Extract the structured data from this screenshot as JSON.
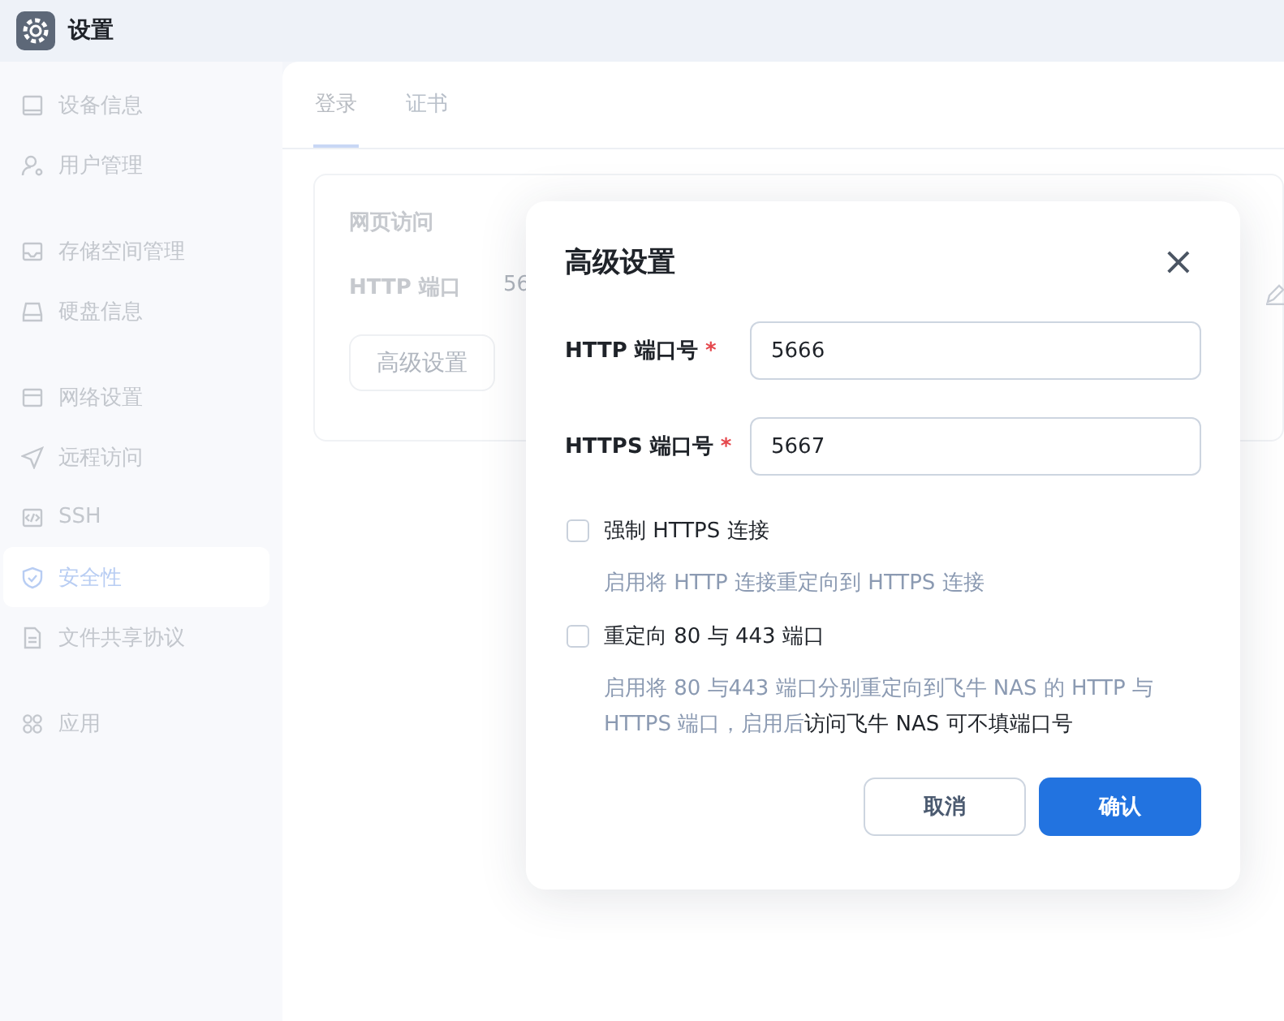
{
  "window": {
    "title": "设置"
  },
  "sidebar": {
    "groups": [
      {
        "items": [
          {
            "label": "设备信息",
            "kind": "device",
            "selected": false
          },
          {
            "label": "用户管理",
            "kind": "user",
            "selected": false
          }
        ]
      },
      {
        "items": [
          {
            "label": "存储空间管理",
            "kind": "storage",
            "selected": false
          },
          {
            "label": "硬盘信息",
            "kind": "disk",
            "selected": false
          }
        ]
      },
      {
        "items": [
          {
            "label": "网络设置",
            "kind": "network",
            "selected": false
          },
          {
            "label": "远程访问",
            "kind": "send",
            "selected": false
          },
          {
            "label": "SSH",
            "kind": "code",
            "selected": false
          },
          {
            "label": "安全性",
            "kind": "shield",
            "selected": true
          },
          {
            "label": "文件共享协议",
            "kind": "file",
            "selected": false
          }
        ]
      },
      {
        "items": [
          {
            "label": "应用",
            "kind": "apps",
            "selected": false
          }
        ]
      }
    ]
  },
  "tabs": [
    {
      "label": "登录",
      "selected": true
    },
    {
      "label": "证书",
      "selected": false
    }
  ],
  "card": {
    "title": "网页访问",
    "field_label": "HTTP 端口",
    "field_value": "56",
    "button": "高级设置"
  },
  "dialog": {
    "title": "高级设置",
    "close": "×",
    "fields": [
      {
        "label": "HTTP 端口号",
        "required": "*",
        "value": "5666"
      },
      {
        "label": "HTTPS 端口号",
        "required": "*",
        "value": "5667"
      }
    ],
    "options": [
      {
        "label": "强制 HTTPS 连接",
        "checked": false,
        "hint": "启用将 HTTP 连接重定向到 HTTPS 连接"
      },
      {
        "label": "重定向 80 与 443 端口",
        "checked": false,
        "hint": "启用将 80 与443 端口分别重定向到飞牛 NAS 的 HTTP 与 HTTPS 端口，启用后",
        "hint_dark": "访问飞牛 NAS 可不填端口号"
      }
    ],
    "buttons": [
      {
        "label": "取消",
        "kind": "secondary"
      },
      {
        "label": "确认",
        "kind": "primary"
      }
    ]
  }
}
